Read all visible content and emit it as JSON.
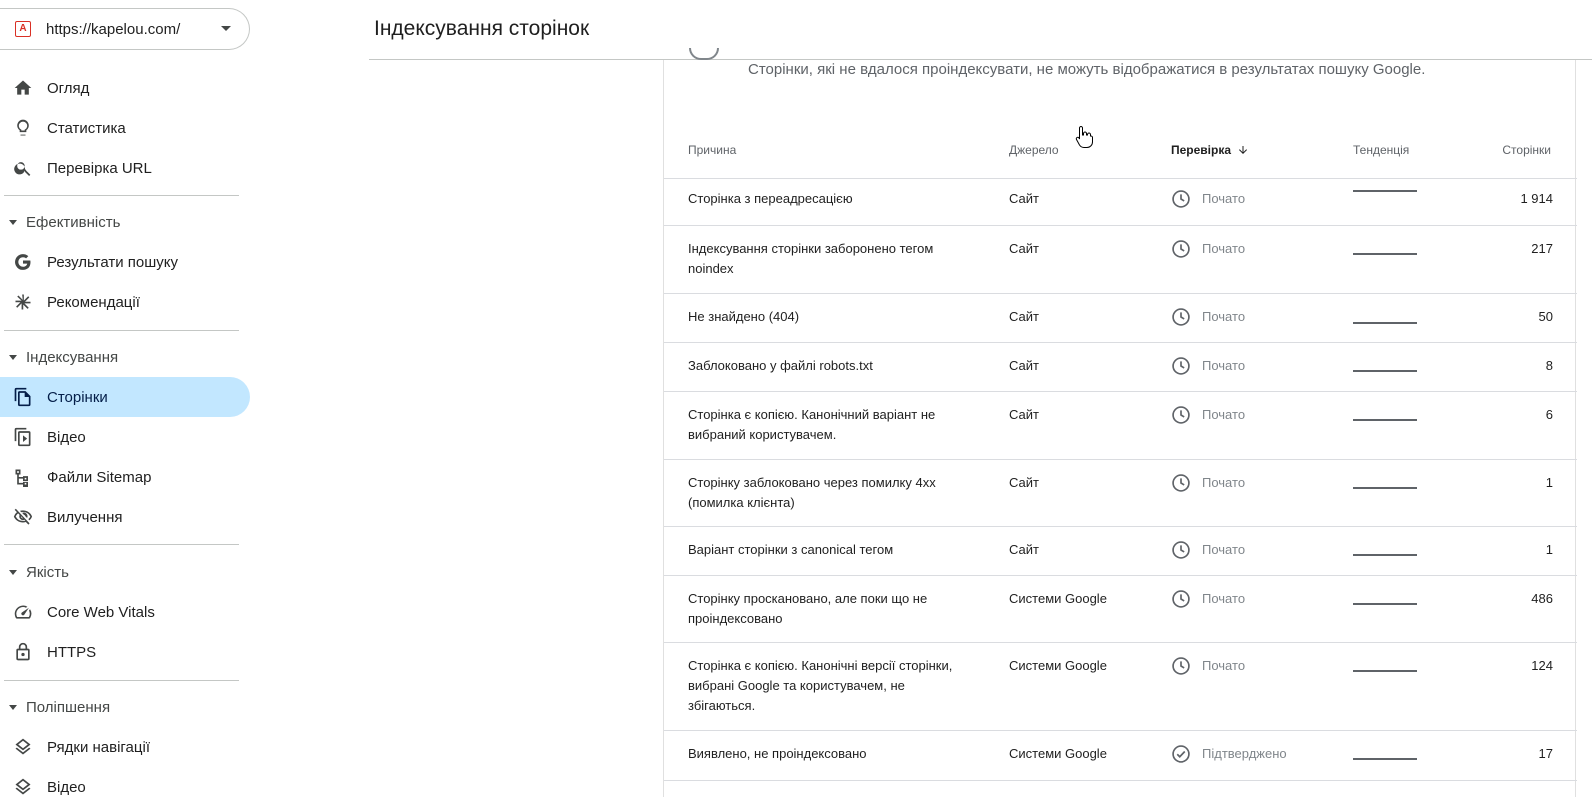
{
  "property": {
    "url": "https://kapelou.com/",
    "logo_letter": "A"
  },
  "header": {
    "title": "Індексування сторінок"
  },
  "sidebar": {
    "top_items": [
      {
        "label": "Огляд",
        "icon": "home-icon"
      },
      {
        "label": "Статистика",
        "icon": "lightbulb-icon"
      },
      {
        "label": "Перевірка URL",
        "icon": "search-icon"
      }
    ],
    "sections": [
      {
        "title": "Ефективність",
        "items": [
          {
            "label": "Результати пошуку",
            "icon": "google-g-icon"
          },
          {
            "label": "Рекомендації",
            "icon": "asterisk-icon"
          }
        ]
      },
      {
        "title": "Індексування",
        "items": [
          {
            "label": "Сторінки",
            "icon": "pages-icon",
            "active": true
          },
          {
            "label": "Відео",
            "icon": "video-page-icon"
          },
          {
            "label": "Файли Sitemap",
            "icon": "sitemap-icon"
          },
          {
            "label": "Вилучення",
            "icon": "eye-off-icon"
          }
        ]
      },
      {
        "title": "Якість",
        "items": [
          {
            "label": "Core Web Vitals",
            "icon": "speed-gauge-icon"
          },
          {
            "label": "HTTPS",
            "icon": "lock-icon"
          }
        ]
      },
      {
        "title": "Поліпшення",
        "items": [
          {
            "label": "Рядки навігації",
            "icon": "layers-icon"
          },
          {
            "label": "Відео",
            "icon": "layers-icon"
          }
        ]
      }
    ]
  },
  "card": {
    "description": "Сторінки, які не вдалося проіндексувати, не можуть відображатися в результатах пошуку Google."
  },
  "table": {
    "columns": {
      "reason": "Причина",
      "source": "Джерело",
      "check": "Перевірка",
      "trend": "Тенденція",
      "pages": "Сторінки"
    },
    "sorted_by": "check",
    "rows": [
      {
        "reason": "Сторінка з переадресацією",
        "source": "Сайт",
        "status": "Почато",
        "status_icon": "clock-icon",
        "pages": "1 914"
      },
      {
        "reason": "Індексування сторінки заборонено тегом noindex",
        "source": "Сайт",
        "status": "Почато",
        "status_icon": "clock-icon",
        "pages": "217"
      },
      {
        "reason": "Не знайдено (404)",
        "source": "Сайт",
        "status": "Почато",
        "status_icon": "clock-icon",
        "pages": "50"
      },
      {
        "reason": "Заблоковано у файлі robots.txt",
        "source": "Сайт",
        "status": "Почато",
        "status_icon": "clock-icon",
        "pages": "8"
      },
      {
        "reason": "Сторінка є копією. Канонічний варіант не вибраний користувачем.",
        "source": "Сайт",
        "status": "Почато",
        "status_icon": "clock-icon",
        "pages": "6"
      },
      {
        "reason": "Сторінку заблоковано через помилку 4xx (помилка клієнта)",
        "source": "Сайт",
        "status": "Почато",
        "status_icon": "clock-icon",
        "pages": "1"
      },
      {
        "reason": "Варіант сторінки з canonical тегом",
        "source": "Сайт",
        "status": "Почато",
        "status_icon": "clock-icon",
        "pages": "1"
      },
      {
        "reason": "Сторінку проскановано, але поки що не проіндексовано",
        "source": "Системи Google",
        "status": "Почато",
        "status_icon": "clock-icon",
        "pages": "486"
      },
      {
        "reason": "Сторінка є копією. Канонічні версії сторінки, вибрані Google та користувачем, не збігаються.",
        "source": "Системи Google",
        "status": "Почато",
        "status_icon": "clock-icon",
        "pages": "124"
      },
      {
        "reason": "Виявлено, не проіндексовано",
        "source": "Системи Google",
        "status": "Підтверджено",
        "status_icon": "check-circle-icon",
        "pages": "17"
      }
    ]
  }
}
